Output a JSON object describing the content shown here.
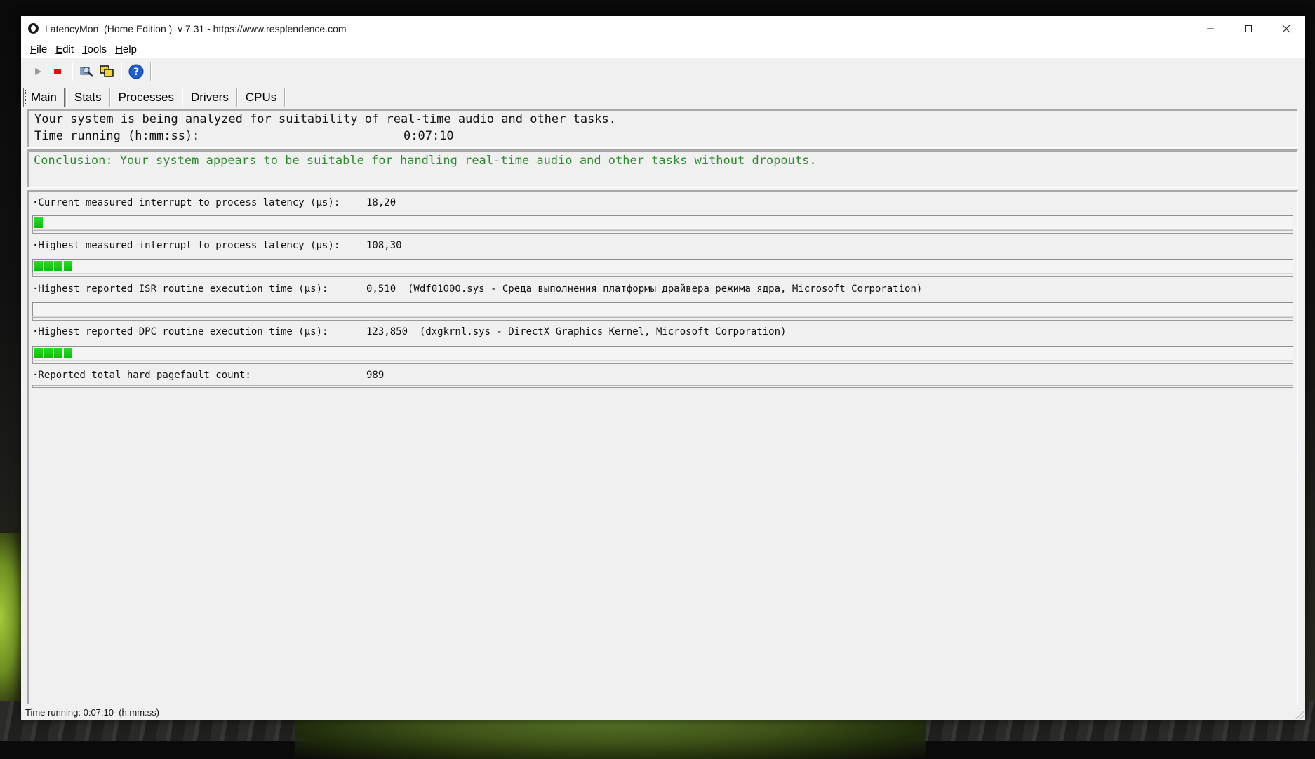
{
  "window": {
    "title": "LatencyMon  (Home Edition )  v 7.31 - https://www.resplendence.com"
  },
  "menu": [
    {
      "accel": "F",
      "rest": "ile"
    },
    {
      "accel": "E",
      "rest": "dit"
    },
    {
      "accel": "T",
      "rest": "ools"
    },
    {
      "accel": "H",
      "rest": "elp"
    }
  ],
  "toolbar": {
    "icons": [
      "play-icon",
      "stop-icon",
      "drivers-icon",
      "windows-icon",
      "help-icon"
    ]
  },
  "tabs": [
    {
      "accel": "M",
      "rest": "ain"
    },
    {
      "accel": "S",
      "rest": "tats"
    },
    {
      "accel": "P",
      "rest": "rocesses"
    },
    {
      "accel": "D",
      "rest": "rivers"
    },
    {
      "accel": "C",
      "rest": "PUs"
    }
  ],
  "summary": {
    "line1": "Your system is being analyzed for suitability of real-time audio and other tasks.",
    "time_label": "Time running (h:mm:ss):",
    "time_value": "0:07:10"
  },
  "conclusion": "Conclusion: Your system appears to be suitable for handling real-time audio and other tasks without dropouts.",
  "metrics": [
    {
      "label": "·Current measured interrupt to process latency (µs):",
      "value": "18,20",
      "bar_segments": 1
    },
    {
      "label": "·Highest measured interrupt to process latency (µs):",
      "value": "108,30",
      "bar_segments": 4
    },
    {
      "label": "·Highest reported ISR routine execution time (µs):",
      "value": "0,510  (Wdf01000.sys - Среда выполнения платформы драйвера режима ядра, Microsoft Corporation)",
      "bar_segments": 0
    },
    {
      "label": "·Highest reported DPC routine execution time (µs):",
      "value": "123,850  (dxgkrnl.sys - DirectX Graphics Kernel, Microsoft Corporation)",
      "bar_segments": 4
    },
    {
      "label": "·Reported total hard pagefault count:",
      "value": "989",
      "bar_segments": null
    }
  ],
  "colors": {
    "accent_green": "#0bbb0b",
    "conclusion_text": "#2c8a2c",
    "stop_red": "#e01010",
    "help_blue": "#1d5fd1"
  },
  "status": {
    "text": "Time running: 0:07:10  (h:mm:ss)"
  }
}
